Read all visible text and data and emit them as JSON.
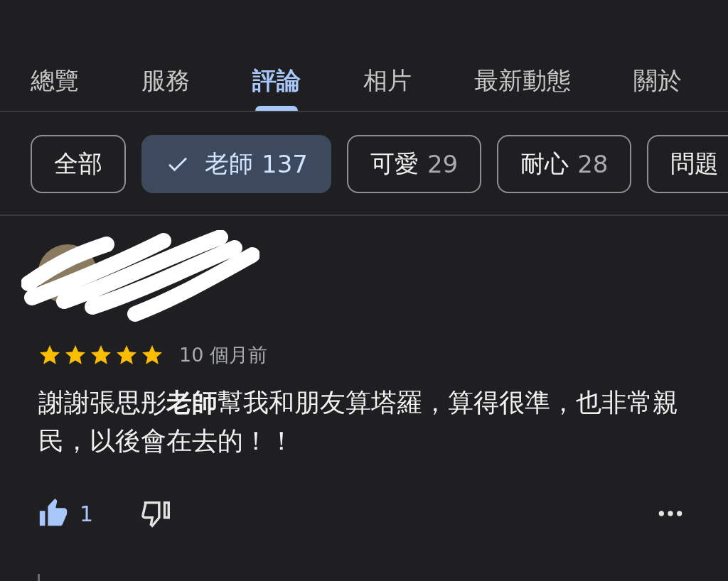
{
  "tabs": [
    {
      "label": "總覽",
      "selected": false
    },
    {
      "label": "服務",
      "selected": false
    },
    {
      "label": "評論",
      "selected": true
    },
    {
      "label": "相片",
      "selected": false
    },
    {
      "label": "最新動態",
      "selected": false
    },
    {
      "label": "關於",
      "selected": false
    }
  ],
  "filters": [
    {
      "label": "全部",
      "selected": false
    },
    {
      "label": "老師",
      "count": "137",
      "selected": true
    },
    {
      "label": "可愛",
      "count": "29",
      "selected": false
    },
    {
      "label": "耐心",
      "count": "28",
      "selected": false
    },
    {
      "label": "問題",
      "selected": false
    }
  ],
  "review": {
    "stars": 5,
    "time": "10 個月前",
    "text": "謝謝張思彤**老師**幫我和朋友算塔羅，算得很準，也非常親民，以後會在去的！！",
    "likes": "1"
  }
}
